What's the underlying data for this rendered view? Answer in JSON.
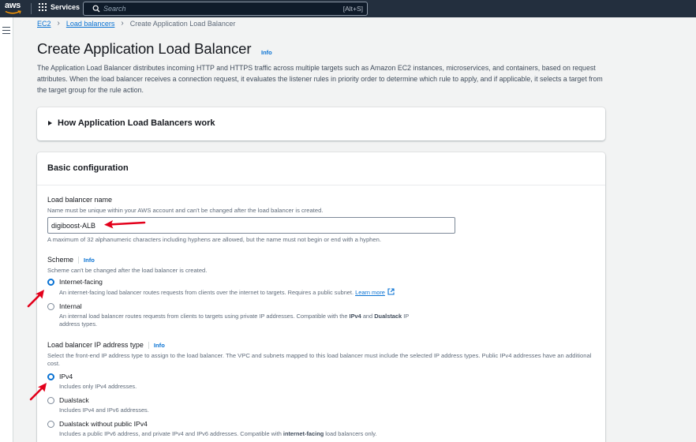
{
  "topnav": {
    "logo_text": "aws",
    "services_label": "Services",
    "search_placeholder": "Search",
    "search_shortcut": "[Alt+S]",
    "background": "#232f3e"
  },
  "breadcrumb": {
    "items": [
      "EC2",
      "Load balancers"
    ],
    "current": "Create Application Load Balancer"
  },
  "header": {
    "title": "Create Application Load Balancer",
    "info_label": "Info",
    "description": "The Application Load Balancer distributes incoming HTTP and HTTPS traffic across multiple targets such as Amazon EC2 instances, microservices, and containers, based on request attributes. When the load balancer receives a connection request, it evaluates the listener rules in priority order to determine which rule to apply, and if applicable, it selects a target from the target group for the rule action."
  },
  "how_section": {
    "title": "How Application Load Balancers work"
  },
  "basic_config": {
    "title": "Basic configuration",
    "name_field": {
      "label": "Load balancer name",
      "hint": "Name must be unique within your AWS account and can't be changed after the load balancer is created.",
      "value": "digiboost-ALB",
      "constraint": "A maximum of 32 alphanumeric characters including hyphens are allowed, but the name must not begin or end with a hyphen."
    },
    "scheme": {
      "label": "Scheme",
      "info_label": "Info",
      "hint": "Scheme can't be changed after the load balancer is created.",
      "options": [
        {
          "label": "Internet-facing",
          "desc": "An internet-facing load balancer routes requests from clients over the internet to targets. Requires a public subnet.",
          "link": "Learn more",
          "checked": true
        },
        {
          "label": "Internal",
          "desc_parts": [
            "An internal load balancer routes requests from clients to targets using private IP addresses. Compatible with the ",
            "IPv4",
            " and ",
            "Dualstack",
            " IP",
            "address types."
          ],
          "checked": false
        }
      ]
    },
    "ip_type": {
      "label": "Load balancer IP address type",
      "info_label": "Info",
      "hint": "Select the front-end IP address type to assign to the load balancer. The VPC and subnets mapped to this load balancer must include the selected IP address types. Public IPv4 addresses have an additional cost.",
      "options": [
        {
          "label": "IPv4",
          "desc": "Includes only IPv4 addresses.",
          "checked": true
        },
        {
          "label": "Dualstack",
          "desc": "Includes IPv4 and IPv6 addresses.",
          "checked": false
        },
        {
          "label": "Dualstack without public IPv4",
          "desc_parts": [
            "Includes a public IPv6 address, and private IPv4 and IPv6 addresses. Compatible with ",
            "internet-facing",
            " load balancers only."
          ],
          "checked": false
        }
      ]
    }
  },
  "colors": {
    "accent": "#0972d3",
    "annotation_arrow": "#e3001b",
    "page_bg": "#f2f3f3"
  }
}
